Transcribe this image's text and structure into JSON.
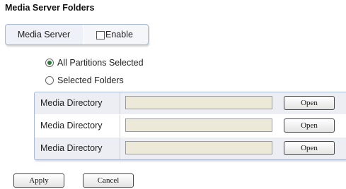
{
  "page": {
    "title": "Media Server Folders"
  },
  "media_server": {
    "label": "Media Server",
    "enable_label": "Enable",
    "enabled": false
  },
  "partition_options": [
    {
      "label": "All Partitions Selected",
      "selected": true
    },
    {
      "label": "Selected Folders",
      "selected": false
    }
  ],
  "directories": [
    {
      "label": "Media Directory",
      "value": "",
      "button": "Open"
    },
    {
      "label": "Media Directory",
      "value": "",
      "button": "Open"
    },
    {
      "label": "Media Directory",
      "value": "",
      "button": "Open"
    }
  ],
  "actions": {
    "apply": "Apply",
    "cancel": "Cancel"
  },
  "colors": {
    "panel_border": "#a9b9d6",
    "row_shade": "#eceef4",
    "input_bg": "#ece9d8",
    "radio_selected": "#2a7a3a"
  }
}
